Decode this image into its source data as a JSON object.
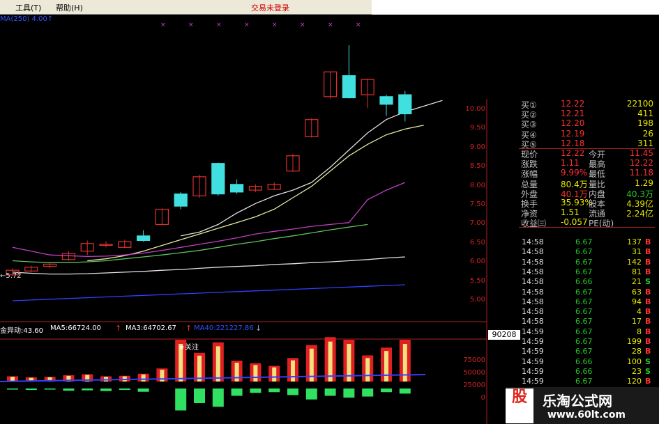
{
  "menu": {
    "tools": "工具",
    "tools_key": "(T)",
    "help": "帮助",
    "help_key": "(H)",
    "trade_status": "交易未登录"
  },
  "header_line": "MA(250) 4.00↑",
  "price_axis": [
    "10.00",
    "9.50",
    "9.00",
    "8.50",
    "8.00",
    "7.50",
    "7.00",
    "6.50",
    "6.00",
    "5.50",
    "5.00"
  ],
  "low_marker": "←5.72",
  "indicator": {
    "name": "金异动:43.60",
    "ma5": "MA5:66724.00",
    "ma3": "MA3:64702.67",
    "ma40": "MA40:221227.86",
    "axis": [
      "75000",
      "50000",
      "25000",
      "0"
    ],
    "tag_follow": "关注",
    "vol_box": "90208"
  },
  "quote": [
    {
      "k": "买①",
      "v": "12.22",
      "v2": "22100"
    },
    {
      "k": "买②",
      "v": "12.21",
      "v2": "411"
    },
    {
      "k": "买③",
      "v": "12.20",
      "v2": "198"
    },
    {
      "k": "买④",
      "v": "12.19",
      "v2": "26"
    },
    {
      "k": "买⑤",
      "v": "12.18",
      "v2": "311"
    }
  ],
  "stats": [
    {
      "k": "现价",
      "v": "12.22",
      "k2": "今开",
      "v2": "11.45",
      "c": "#ff3030",
      "c2": "#ff3030"
    },
    {
      "k": "涨跌",
      "v": "1.11",
      "k2": "最高",
      "v2": "12.22",
      "c": "#ff3030",
      "c2": "#ff3030"
    },
    {
      "k": "涨幅",
      "v": "9.99%",
      "k2": "最低",
      "v2": "11.18",
      "c": "#ff3030",
      "c2": "#ff3030"
    },
    {
      "k": "总量",
      "v": "80.4万",
      "k2": "量比",
      "v2": "1.29",
      "c": "#e6e600",
      "c2": "#e6e600"
    },
    {
      "k": "外盘",
      "v": "40.1万",
      "k2": "内盘",
      "v2": "40.3万",
      "c": "#ff3030",
      "c2": "#28c828"
    },
    {
      "k": "换手",
      "v": "35.93%",
      "k2": "股本",
      "v2": "4.39亿",
      "c": "#e6e600",
      "c2": "#e6e600"
    },
    {
      "k": "净资",
      "v": "1.51",
      "k2": "流通",
      "v2": "2.24亿",
      "c": "#e6e600",
      "c2": "#e6e600"
    },
    {
      "k": "收益㈢",
      "v": "-0.057",
      "k2": "PE(动)",
      "v2": "",
      "c": "#e6e600",
      "c2": "#e6e600"
    }
  ],
  "ticks": [
    {
      "t": "14:58",
      "p": "6.67",
      "vol": "137",
      "bs": "B"
    },
    {
      "t": "14:58",
      "p": "6.67",
      "vol": "31",
      "bs": "B"
    },
    {
      "t": "14:58",
      "p": "6.67",
      "vol": "142",
      "bs": "B"
    },
    {
      "t": "14:58",
      "p": "6.67",
      "vol": "81",
      "bs": "B"
    },
    {
      "t": "14:58",
      "p": "6.66",
      "vol": "21",
      "bs": "S"
    },
    {
      "t": "14:58",
      "p": "6.67",
      "vol": "63",
      "bs": "B"
    },
    {
      "t": "14:58",
      "p": "6.67",
      "vol": "94",
      "bs": "B"
    },
    {
      "t": "14:58",
      "p": "6.67",
      "vol": "4",
      "bs": "B"
    },
    {
      "t": "14:58",
      "p": "6.67",
      "vol": "17",
      "bs": "B"
    },
    {
      "t": "14:59",
      "p": "6.67",
      "vol": "8",
      "bs": "B"
    },
    {
      "t": "14:59",
      "p": "6.67",
      "vol": "199",
      "bs": "B"
    },
    {
      "t": "14:59",
      "p": "6.67",
      "vol": "28",
      "bs": "B"
    },
    {
      "t": "14:59",
      "p": "6.66",
      "vol": "100",
      "bs": "S"
    },
    {
      "t": "14:59",
      "p": "6.66",
      "vol": "23",
      "bs": "S"
    },
    {
      "t": "14:59",
      "p": "6.67",
      "vol": "120",
      "bs": "B"
    }
  ],
  "watermark": {
    "logo": "股",
    "name": "乐淘公式网",
    "url": "www.60lt.com"
  },
  "colors": {
    "up": "#e03030",
    "down": "#40e0e0",
    "ma_white": "#e0e0e0",
    "ma_yellow": "#e6e6a0",
    "ma_purple": "#c040c0",
    "ma_green": "#60c060",
    "ma_blue": "#3040ff"
  },
  "chart_data": {
    "type": "candlestick",
    "y_range": [
      5.0,
      10.0
    ],
    "candles": [
      {
        "o": 5.68,
        "c": 5.8,
        "h": 5.85,
        "l": 5.65
      },
      {
        "o": 5.78,
        "c": 5.88,
        "h": 5.92,
        "l": 5.75
      },
      {
        "o": 5.9,
        "c": 5.96,
        "h": 6.0,
        "l": 5.85
      },
      {
        "o": 6.08,
        "c": 6.24,
        "h": 6.3,
        "l": 6.05
      },
      {
        "o": 6.3,
        "c": 6.5,
        "h": 6.58,
        "l": 6.2
      },
      {
        "o": 6.48,
        "c": 6.48,
        "h": 6.56,
        "l": 6.4
      },
      {
        "o": 6.4,
        "c": 6.55,
        "h": 6.6,
        "l": 6.38
      },
      {
        "o": 6.7,
        "c": 6.58,
        "h": 6.85,
        "l": 6.55
      },
      {
        "o": 7.0,
        "c": 7.4,
        "h": 7.42,
        "l": 6.98
      },
      {
        "o": 7.8,
        "c": 7.48,
        "h": 7.85,
        "l": 7.4
      },
      {
        "o": 7.75,
        "c": 8.25,
        "h": 8.3,
        "l": 7.7
      },
      {
        "o": 8.6,
        "c": 7.8,
        "h": 8.62,
        "l": 7.75
      },
      {
        "o": 8.05,
        "c": 7.85,
        "h": 8.18,
        "l": 7.8
      },
      {
        "o": 7.9,
        "c": 8.0,
        "h": 8.05,
        "l": 7.85
      },
      {
        "o": 7.92,
        "c": 8.05,
        "h": 8.1,
        "l": 7.9
      },
      {
        "o": 8.4,
        "c": 8.8,
        "h": 8.85,
        "l": 8.38
      },
      {
        "o": 9.3,
        "c": 9.75,
        "h": 9.78,
        "l": 9.28
      },
      {
        "o": 10.35,
        "c": 11.0,
        "h": 11.0,
        "l": 10.3
      },
      {
        "o": 10.9,
        "c": 10.32,
        "h": 11.7,
        "l": 10.3
      },
      {
        "o": 10.4,
        "c": 10.8,
        "h": 10.82,
        "l": 10.05
      },
      {
        "o": 10.35,
        "c": 10.15,
        "h": 10.4,
        "l": 9.85
      },
      {
        "o": 10.4,
        "c": 9.9,
        "h": 10.5,
        "l": 9.7
      }
    ],
    "ma_lines": [
      {
        "name": "MA5",
        "color": "#e0e0e0",
        "from_index": 9,
        "values": [
          6.7,
          6.8,
          7.0,
          7.3,
          7.55,
          7.75,
          7.9,
          8.1,
          8.5,
          8.95,
          9.4,
          9.75,
          9.95,
          10.1,
          10.25
        ]
      },
      {
        "name": "MA10",
        "color": "#e6e6a0",
        "from_index": 4,
        "values": [
          6.05,
          6.1,
          6.18,
          6.3,
          6.45,
          6.6,
          6.75,
          6.9,
          7.05,
          7.2,
          7.4,
          7.7,
          8.0,
          8.4,
          8.8,
          9.1,
          9.35,
          9.5,
          9.6
        ]
      },
      {
        "name": "MA20",
        "color": "#c040c0",
        "from_index": 0,
        "values": [
          6.4,
          6.3,
          6.2,
          6.18,
          6.16,
          6.17,
          6.2,
          6.25,
          6.32,
          6.4,
          6.48,
          6.56,
          6.65,
          6.75,
          6.82,
          6.88,
          6.95,
          7.0,
          7.05,
          7.65,
          7.9,
          8.1
        ]
      },
      {
        "name": "MA30",
        "color": "#60c060",
        "from_index": 0,
        "values": [
          6.05,
          6.02,
          6.0,
          6.0,
          6.02,
          6.05,
          6.1,
          6.15,
          6.2,
          6.26,
          6.32,
          6.4,
          6.48,
          6.55,
          6.63,
          6.7,
          6.78,
          6.86,
          6.93,
          7.0
        ]
      },
      {
        "name": "MA60",
        "color": "#e0e0e0",
        "from_index": 0,
        "values": [
          5.75,
          5.72,
          5.7,
          5.7,
          5.71,
          5.73,
          5.75,
          5.77,
          5.8,
          5.82,
          5.85,
          5.88,
          5.9,
          5.92,
          5.95,
          5.97,
          6.0,
          6.02,
          6.05,
          6.08,
          6.12,
          6.15
        ]
      },
      {
        "name": "MA120",
        "color": "#3040ff",
        "from_index": 0,
        "values": [
          5.0,
          5.02,
          5.04,
          5.06,
          5.08,
          5.1,
          5.12,
          5.14,
          5.16,
          5.18,
          5.2,
          5.22,
          5.24,
          5.26,
          5.28,
          5.3,
          5.32,
          5.34,
          5.36,
          5.38,
          5.4,
          5.42
        ]
      }
    ],
    "indicator_bars": [
      {
        "up": 10000,
        "down": 3000
      },
      {
        "up": 8000,
        "down": 4000
      },
      {
        "up": 9000,
        "down": 3000
      },
      {
        "up": 12000,
        "down": 6000
      },
      {
        "up": 14000,
        "down": 5000
      },
      {
        "up": 10000,
        "down": 7000
      },
      {
        "up": 11000,
        "down": 4000
      },
      {
        "up": 15000,
        "down": 9000
      },
      {
        "up": 25000,
        "down": 0
      },
      {
        "up": 80000,
        "down": 60000
      },
      {
        "up": 55000,
        "down": 40000
      },
      {
        "up": 75000,
        "down": 50000
      },
      {
        "up": 40000,
        "down": 20000
      },
      {
        "up": 35000,
        "down": 12000
      },
      {
        "up": 30000,
        "down": 10000
      },
      {
        "up": 45000,
        "down": 18000
      },
      {
        "up": 70000,
        "down": 30000
      },
      {
        "up": 85000,
        "down": 20000
      },
      {
        "up": 80000,
        "down": 25000
      },
      {
        "up": 50000,
        "down": 22000
      },
      {
        "up": 65000,
        "down": 10000
      },
      {
        "up": 80000,
        "down": 14000
      }
    ]
  }
}
